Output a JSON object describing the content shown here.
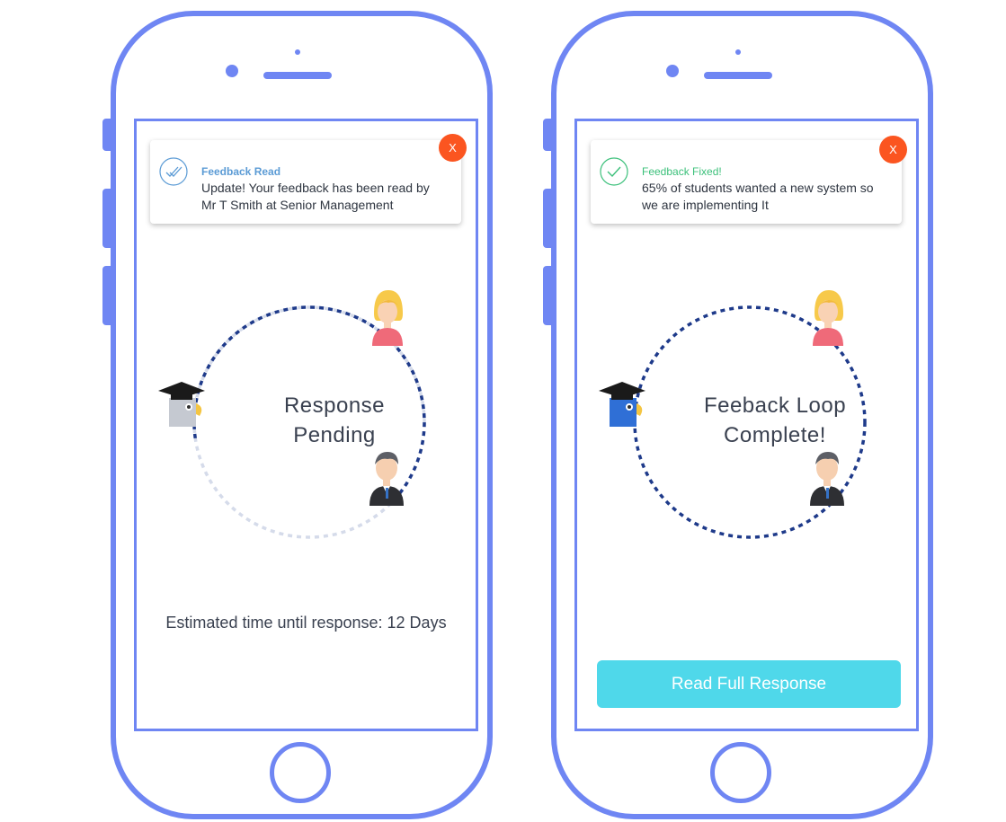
{
  "phones": [
    {
      "notification": {
        "title": "Feedback Read",
        "body": "Update! Your feedback has been read by Mr T Smith at Senior Management",
        "close_label": "X",
        "accent": "#5b9bd5",
        "icon": "double-check-icon"
      },
      "loop": {
        "status_line1": "Response",
        "status_line2": "Pending",
        "progress": 0.65
      },
      "estimate": "Estimated time until response: 12 Days"
    },
    {
      "notification": {
        "title": "Feedback Fixed!",
        "body": "65% of students wanted a new system so we are implementing It",
        "close_label": "X",
        "accent": "#3bc07a",
        "icon": "check-icon"
      },
      "loop": {
        "status_line1": "Feeback Loop",
        "status_line2": "Complete!",
        "progress": 1
      },
      "cta_label": "Read Full Response"
    }
  ],
  "colors": {
    "phone_outline": "#6f86f3",
    "close": "#fb5520",
    "cta": "#4fd8ea",
    "loop_dots": "#1e3a8a"
  }
}
